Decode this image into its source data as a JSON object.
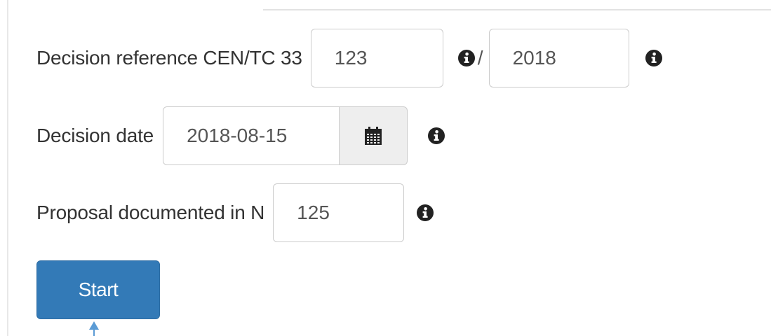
{
  "form": {
    "decision_reference": {
      "label": "Decision reference CEN/TC 33",
      "number_value": "123",
      "separator": "/",
      "year_value": "2018"
    },
    "decision_date": {
      "label": "Decision date",
      "value": "2018-08-15"
    },
    "proposal": {
      "label": "Proposal documented in N",
      "value": "125"
    },
    "start_button_label": "Start"
  },
  "icons": {
    "info": "info-circle-icon",
    "calendar": "calendar-icon",
    "cursor": "arrow-cursor-icon"
  },
  "colors": {
    "primary_button": "#337ab7",
    "text": "#333333",
    "input_border": "#cccccc",
    "addon_background": "#eeeeee",
    "icon": "#222222"
  }
}
